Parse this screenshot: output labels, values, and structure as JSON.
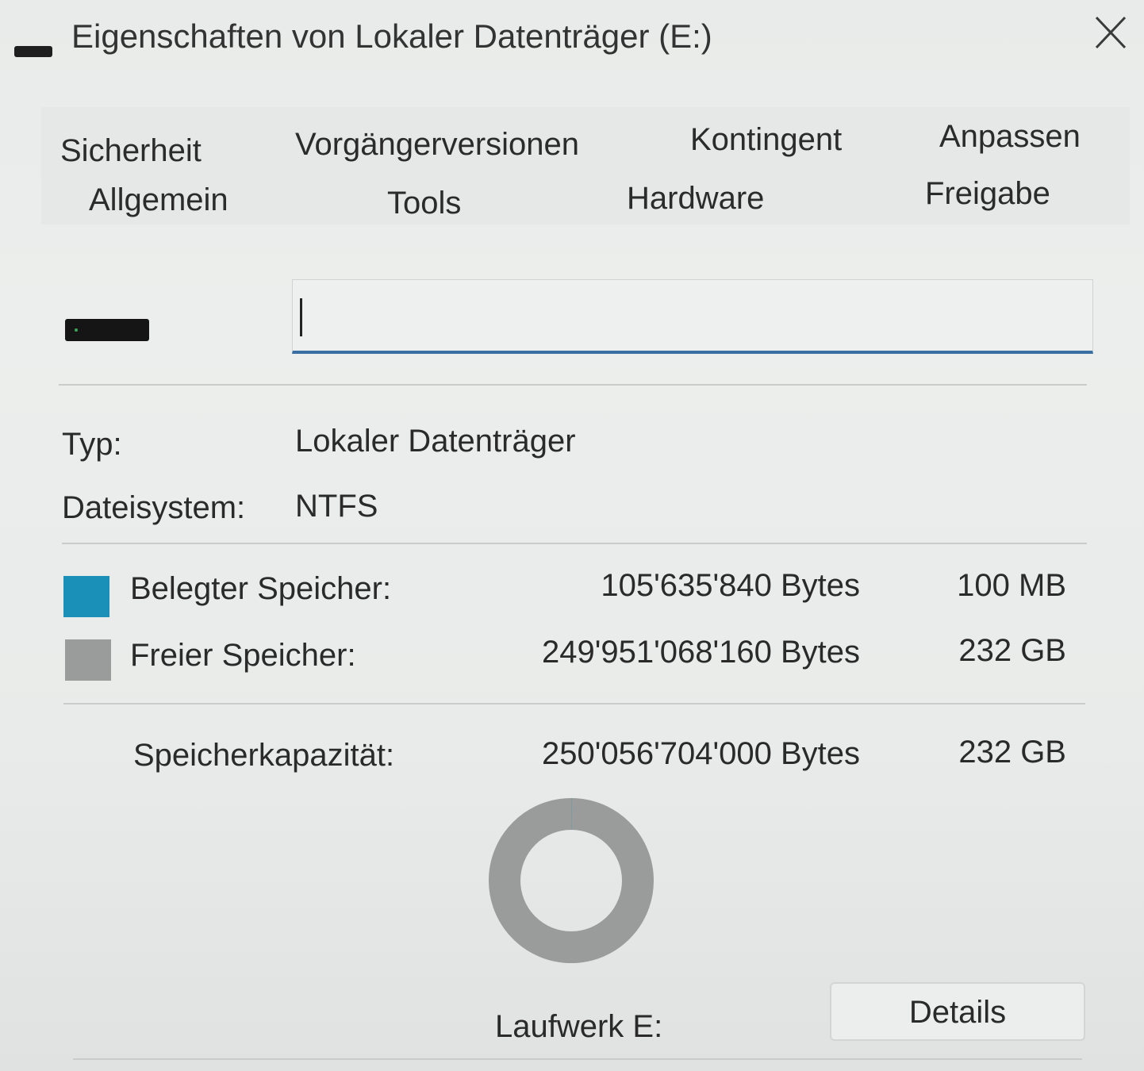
{
  "window": {
    "title": "Eigenschaften von Lokaler Datenträger (E:)"
  },
  "tabs": {
    "row1": [
      {
        "label": "Sicherheit"
      },
      {
        "label": "Vorgängerversionen"
      },
      {
        "label": "Kontingent"
      },
      {
        "label": "Anpassen"
      }
    ],
    "row2": [
      {
        "label": "Allgemein"
      },
      {
        "label": "Tools"
      },
      {
        "label": "Hardware"
      },
      {
        "label": "Freigabe"
      }
    ]
  },
  "general": {
    "name_value": "",
    "type_label": "Typ:",
    "type_value": "Lokaler Datenträger",
    "fs_label": "Dateisystem:",
    "fs_value": "NTFS"
  },
  "storage": {
    "used": {
      "label": "Belegter Speicher:",
      "bytes": "105'635'840 Bytes",
      "size": "100 MB",
      "color": "#1a8fb8"
    },
    "free": {
      "label": "Freier Speicher:",
      "bytes": "249'951'068'160 Bytes",
      "size": "232 GB",
      "color": "#9a9c9b"
    },
    "capacity": {
      "label": "Speicherkapazität:",
      "bytes": "250'056'704'000 Bytes",
      "size": "232 GB"
    },
    "used_fraction": 0.0004
  },
  "drive": {
    "label": "Laufwerk E:",
    "details_button": "Details"
  },
  "icons": {
    "title": "drive-icon",
    "close": "close-icon",
    "drive": "drive-icon"
  }
}
